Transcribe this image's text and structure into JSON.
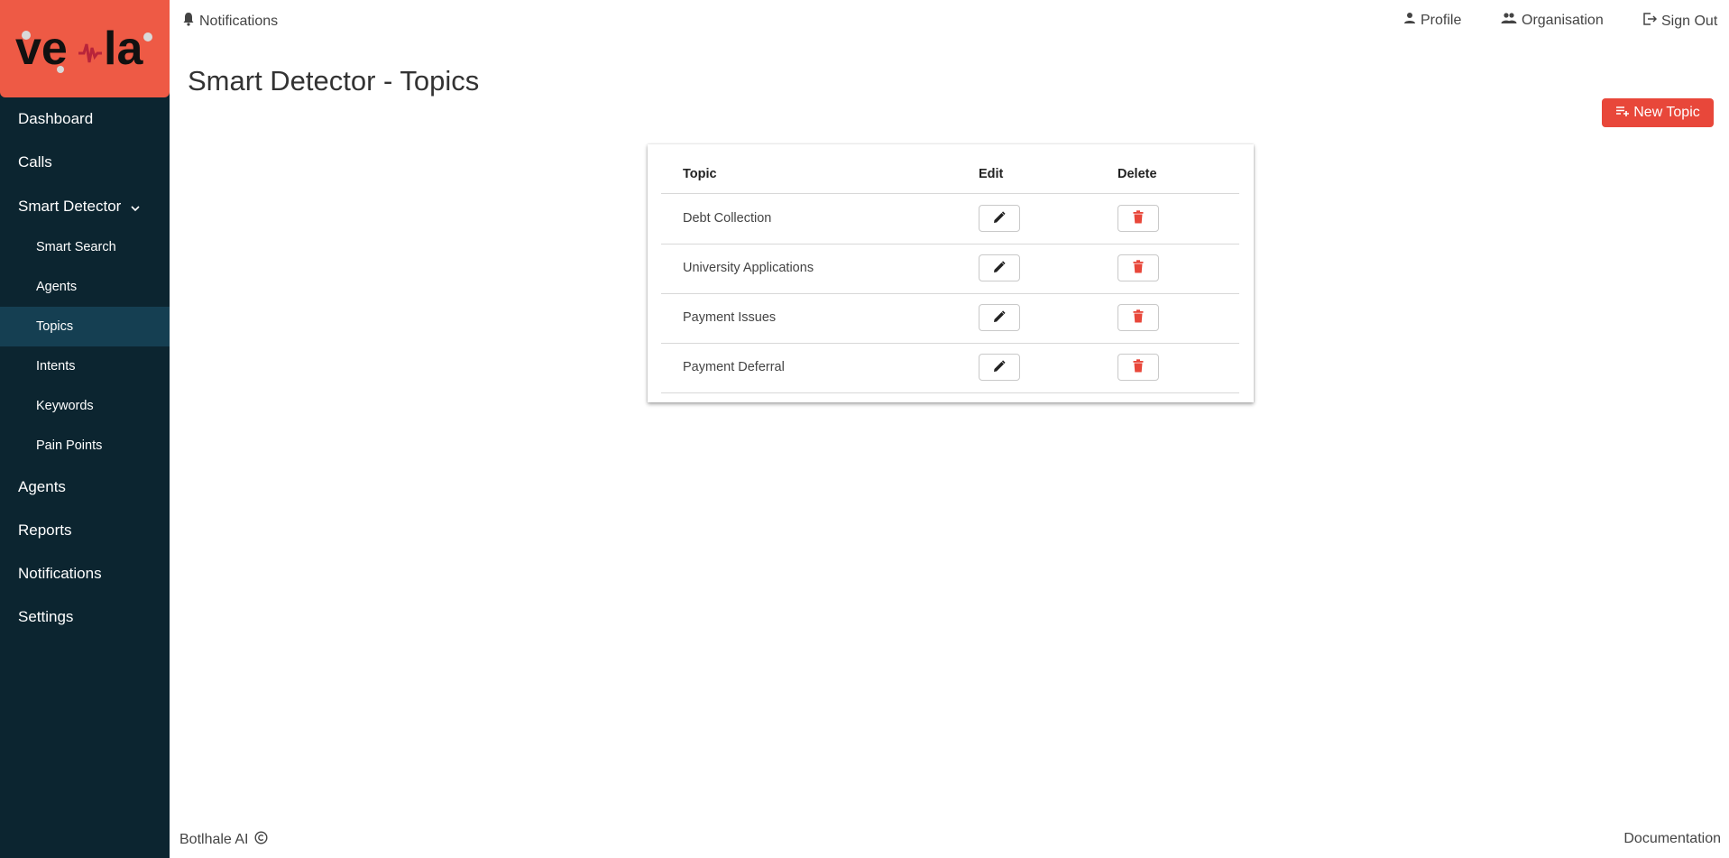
{
  "app": {
    "logo_text": "vela",
    "brand_color": "#ee5a45",
    "sidebar_color": "#0c2530",
    "active_color": "#153f52"
  },
  "topbar": {
    "notifications": "Notifications",
    "profile": "Profile",
    "organisation": "Organisation",
    "sign_out": "Sign Out"
  },
  "sidebar": {
    "items": [
      {
        "label": "Dashboard",
        "icon": ""
      },
      {
        "label": "Calls",
        "icon": ""
      },
      {
        "label": "Smart Detector",
        "icon": "chevron-down-icon"
      },
      {
        "label": "Agents",
        "icon": ""
      },
      {
        "label": "Reports",
        "icon": ""
      },
      {
        "label": "Notifications",
        "icon": ""
      },
      {
        "label": "Settings",
        "icon": ""
      }
    ],
    "subitems": [
      {
        "label": "Smart Search"
      },
      {
        "label": "Agents"
      },
      {
        "label": "Topics",
        "active": true
      },
      {
        "label": "Intents"
      },
      {
        "label": "Keywords"
      },
      {
        "label": "Pain Points"
      }
    ]
  },
  "main": {
    "title": "Smart Detector - Topics",
    "new_topic_label": "New Topic",
    "table": {
      "columns": [
        "Topic",
        "Edit",
        "Delete"
      ],
      "rows": [
        {
          "topic": "Debt Collection"
        },
        {
          "topic": "University Applications"
        },
        {
          "topic": "Payment Issues"
        },
        {
          "topic": "Payment Deferral"
        }
      ]
    }
  },
  "footer": {
    "left": "Botlhale AI",
    "right": "Documentation"
  }
}
